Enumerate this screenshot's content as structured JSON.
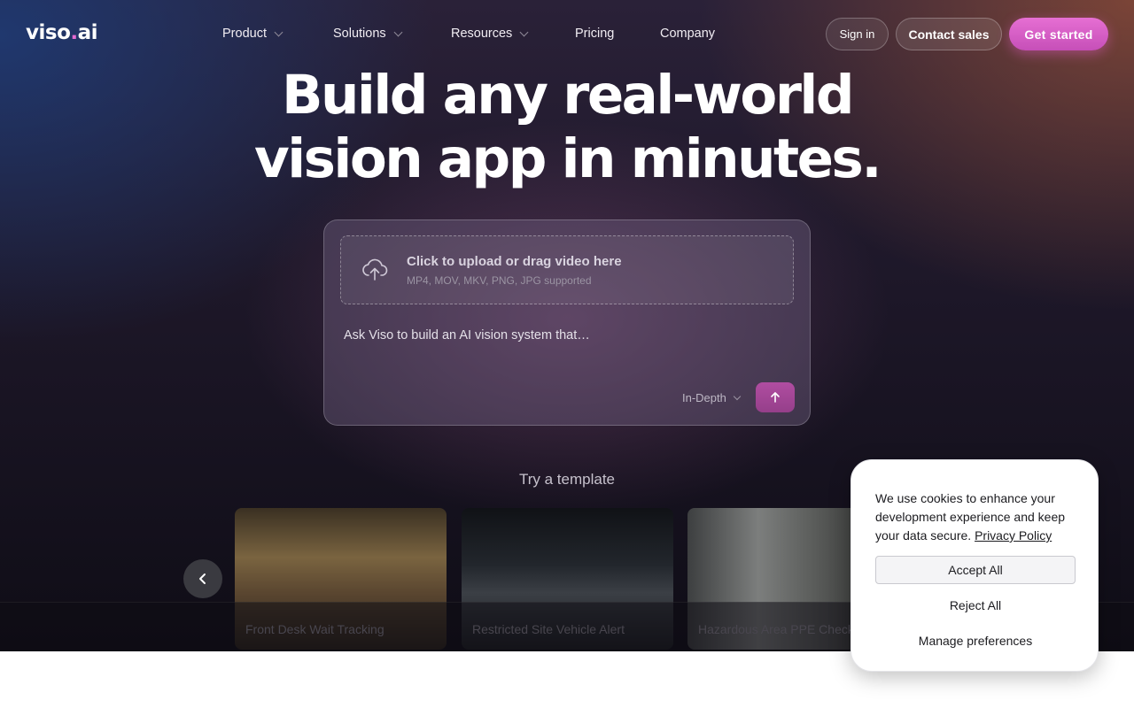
{
  "nav": {
    "logo_main": "viso",
    "logo_dot": ".",
    "logo_suffix": "ai",
    "items": [
      {
        "label": "Product"
      },
      {
        "label": "Solutions"
      },
      {
        "label": "Resources"
      },
      {
        "label": "Pricing"
      },
      {
        "label": "Company"
      }
    ],
    "sign_in": "Sign in",
    "contact_sales": "Contact sales",
    "get_started": "Get started"
  },
  "hero": {
    "headline_line1": "Build any real-world",
    "headline_line2": "vision app in minutes."
  },
  "prompt_card": {
    "upload_title": "Click to upload or drag video here",
    "upload_formats": "MP4, MOV, MKV, PNG, JPG supported",
    "prompt_placeholder": "Ask Viso to build an AI vision system that…",
    "mode": "In-Depth",
    "upload_icon": "cloud-upload-icon",
    "send_icon": "arrow-up-icon"
  },
  "templates": {
    "heading": "Try a template",
    "items": [
      {
        "label": "Front Desk Wait Tracking"
      },
      {
        "label": "Restricted Site Vehicle Alert"
      },
      {
        "label": "Hazardous Area PPE Check"
      }
    ]
  },
  "cookie": {
    "message": "We use cookies to enhance your development experience and keep your data secure.",
    "privacy_link": "Privacy Policy",
    "accept": "Accept All",
    "reject": "Reject All",
    "manage": "Manage preferences"
  },
  "colors": {
    "accent": "#d95fc7",
    "send_button": "#a54696"
  }
}
